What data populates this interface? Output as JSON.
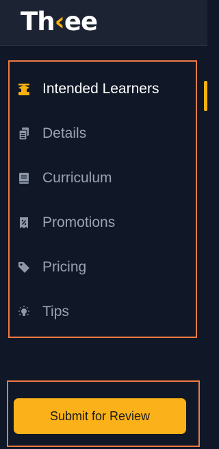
{
  "app": {
    "logo_prefix": "Th",
    "logo_accent": "‹",
    "logo_suffix": "ee",
    "accent_color": "#f8b010"
  },
  "sidebar": {
    "items": [
      {
        "label": "Intended Learners",
        "icon": "graduation-cap-icon",
        "active": true
      },
      {
        "label": "Details",
        "icon": "documents-icon",
        "active": false
      },
      {
        "label": "Curriculum",
        "icon": "book-icon",
        "active": false
      },
      {
        "label": "Promotions",
        "icon": "coupon-icon",
        "active": false
      },
      {
        "label": "Pricing",
        "icon": "tag-icon",
        "active": false
      },
      {
        "label": "Tips",
        "icon": "lightbulb-icon",
        "active": false
      }
    ]
  },
  "footer": {
    "submit_label": "Submit for Review"
  }
}
